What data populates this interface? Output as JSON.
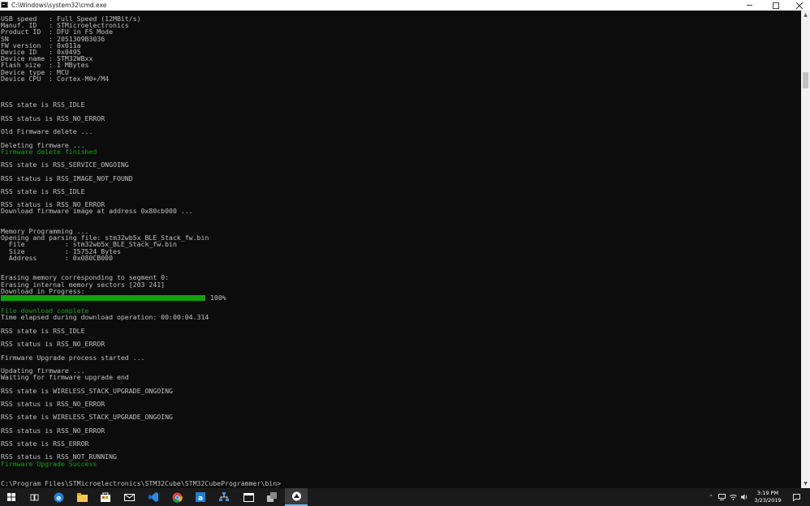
{
  "window": {
    "title": "C:\\Windows\\system32\\cmd.exe"
  },
  "console": {
    "lines": [
      {
        "text": "USB speed   : Full Speed (12MBit/s)",
        "color": "gray"
      },
      {
        "text": "Manuf. ID   : STMicroelectronics",
        "color": "gray"
      },
      {
        "text": "Product ID  : DFU in FS Mode",
        "color": "gray"
      },
      {
        "text": "SN          : 2051309B3036",
        "color": "gray"
      },
      {
        "text": "FW version  : 0x011a",
        "color": "gray"
      },
      {
        "text": "Device ID   : 0x0495",
        "color": "gray"
      },
      {
        "text": "Device name : STM32WBxx",
        "color": "gray"
      },
      {
        "text": "Flash size  : 1 MBytes",
        "color": "gray"
      },
      {
        "text": "Device type : MCU",
        "color": "gray"
      },
      {
        "text": "Device CPU  : Cortex-M0+/M4",
        "color": "gray"
      },
      {
        "text": "",
        "color": "gray"
      },
      {
        "text": "",
        "color": "gray"
      },
      {
        "text": "",
        "color": "gray"
      },
      {
        "text": "RSS state is RSS_IDLE",
        "color": "gray"
      },
      {
        "text": "",
        "color": "gray"
      },
      {
        "text": "RSS status is RSS_NO_ERROR",
        "color": "gray"
      },
      {
        "text": "",
        "color": "gray"
      },
      {
        "text": "Old Firmware delete ...",
        "color": "gray"
      },
      {
        "text": "",
        "color": "gray"
      },
      {
        "text": "Deleting firmware ...",
        "color": "gray"
      },
      {
        "text": "Firmware delete finished",
        "color": "green"
      },
      {
        "text": "",
        "color": "gray"
      },
      {
        "text": "RSS state is RSS_SERVICE_ONGOING",
        "color": "gray"
      },
      {
        "text": "",
        "color": "gray"
      },
      {
        "text": "RSS status is RSS_IMAGE_NOT_FOUND",
        "color": "gray"
      },
      {
        "text": "",
        "color": "gray"
      },
      {
        "text": "RSS state is RSS_IDLE",
        "color": "gray"
      },
      {
        "text": "",
        "color": "gray"
      },
      {
        "text": "RSS status is RSS_NO_ERROR",
        "color": "gray"
      },
      {
        "text": "Download firmware image at address 0x80cb000 ...",
        "color": "gray"
      },
      {
        "text": "",
        "color": "gray"
      },
      {
        "text": "",
        "color": "gray"
      },
      {
        "text": "Memory Programming ...",
        "color": "gray"
      },
      {
        "text": "Opening and parsing file: stm32wb5x_BLE_Stack_fw.bin",
        "color": "gray"
      },
      {
        "text": "  File          : stm32wb5x_BLE_Stack_fw.bin",
        "color": "gray"
      },
      {
        "text": "  Size          : 157524 Bytes",
        "color": "gray"
      },
      {
        "text": "  Address       : 0x080CB000",
        "color": "gray"
      },
      {
        "text": "",
        "color": "gray"
      },
      {
        "text": "",
        "color": "gray"
      },
      {
        "text": "Erasing memory corresponding to segment 0:",
        "color": "gray"
      },
      {
        "text": "Erasing internal memory sectors [203 241]",
        "color": "gray"
      },
      {
        "text": "Download in Progress:",
        "color": "gray"
      },
      {
        "text": "",
        "color": "gray",
        "progress": true
      },
      {
        "text": "",
        "color": "gray"
      },
      {
        "text": "File download complete",
        "color": "green"
      },
      {
        "text": "Time elapsed during download operation: 00:00:04.314",
        "color": "gray"
      },
      {
        "text": "",
        "color": "gray"
      },
      {
        "text": "RSS state is RSS_IDLE",
        "color": "gray"
      },
      {
        "text": "",
        "color": "gray"
      },
      {
        "text": "RSS status is RSS_NO_ERROR",
        "color": "gray"
      },
      {
        "text": "",
        "color": "gray"
      },
      {
        "text": "Firmware Upgrade process started ...",
        "color": "gray"
      },
      {
        "text": "",
        "color": "gray"
      },
      {
        "text": "Updating firmware ...",
        "color": "gray"
      },
      {
        "text": "Waiting for firmware upgrade end",
        "color": "gray"
      },
      {
        "text": "",
        "color": "gray"
      },
      {
        "text": "RSS state is WIRELESS_STACK_UPGRADE_ONGOING",
        "color": "gray"
      },
      {
        "text": "",
        "color": "gray"
      },
      {
        "text": "RSS status is RSS_NO_ERROR",
        "color": "gray"
      },
      {
        "text": "",
        "color": "gray"
      },
      {
        "text": "RSS state is WIRELESS_STACK_UPGRADE_ONGOING",
        "color": "gray"
      },
      {
        "text": "",
        "color": "gray"
      },
      {
        "text": "RSS status is RSS_NO_ERROR",
        "color": "gray"
      },
      {
        "text": "",
        "color": "gray"
      },
      {
        "text": "RSS state is RSS_ERROR",
        "color": "gray"
      },
      {
        "text": "",
        "color": "gray"
      },
      {
        "text": "RSS status is RSS_NOT_RUNNING",
        "color": "gray"
      },
      {
        "text": "Firmware Upgrade Success",
        "color": "green"
      },
      {
        "text": "",
        "color": "gray"
      },
      {
        "text": "",
        "color": "gray"
      },
      {
        "text": "C:\\Program Files\\STMicroelectronics\\STM32Cube\\STM32CubeProgrammer\\bin>",
        "color": "gray"
      }
    ],
    "progress": {
      "percent_label": "100%",
      "value": 1.0
    }
  },
  "taskbar": {
    "apps": [
      {
        "name": "start",
        "icon": "windows-logo-icon"
      },
      {
        "name": "task-view",
        "icon": "task-view-icon"
      },
      {
        "name": "edge",
        "icon": "edge-icon"
      },
      {
        "name": "file-explorer",
        "icon": "folder-icon"
      },
      {
        "name": "store",
        "icon": "store-bag-icon"
      },
      {
        "name": "mail",
        "icon": "mail-icon"
      },
      {
        "name": "visual-studio",
        "icon": "visual-studio-icon"
      },
      {
        "name": "chrome",
        "icon": "chrome-icon"
      },
      {
        "name": "azure-app",
        "icon": "a-app-icon"
      },
      {
        "name": "network-app",
        "icon": "network-app-icon"
      },
      {
        "name": "window-app",
        "icon": "window-app-icon"
      },
      {
        "name": "installer-app",
        "icon": "installer-icon"
      },
      {
        "name": "stm32-app",
        "icon": "stm32-cube-icon"
      }
    ],
    "clock": {
      "time": "3:19 PM",
      "date": "3/23/2019"
    }
  },
  "colors": {
    "console_text": "#c0c0c0",
    "console_green": "#13a10e",
    "console_bg": "#0c0c0c",
    "taskbar_bg": "#1a1a1a"
  }
}
